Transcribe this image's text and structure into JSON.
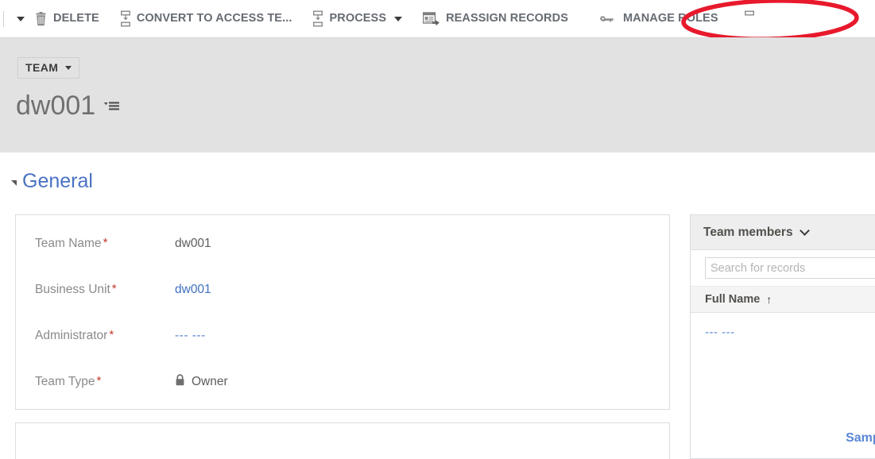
{
  "commandbar": {
    "overflow_caret_icon": "chevron-down-icon",
    "commands": [
      {
        "label": "DELETE",
        "icon": "trash-icon",
        "has_caret": false
      },
      {
        "label": "CONVERT TO ACCESS TE...",
        "icon": "hierarchy-icon",
        "has_caret": false
      },
      {
        "label": "PROCESS",
        "icon": "hierarchy-icon",
        "has_caret": true
      },
      {
        "label": "REASSIGN RECORDS",
        "icon": "reassign-records-icon",
        "has_caret": false
      },
      {
        "label": "MANAGE ROLES",
        "icon": "wrench-icon",
        "has_caret": false
      }
    ]
  },
  "record_header": {
    "entity_chip_label": "TEAM",
    "entity_chip_caret_icon": "caret-down-icon",
    "title": "dw001",
    "title_menu_icon": "record-set-menu-icon"
  },
  "form": {
    "section_title": "General",
    "collapse_icon": "triangle-collapse-icon",
    "required_marker": "*",
    "fields": [
      {
        "label": "Team Name",
        "required": true,
        "value": "dw001",
        "value_style": "text"
      },
      {
        "label": "Business Unit",
        "required": true,
        "value": "dw001",
        "value_style": "link"
      },
      {
        "label": "Administrator",
        "required": true,
        "value": "--- ---",
        "value_style": "link-dashes"
      },
      {
        "label": "Team Type",
        "required": true,
        "value": "Owner",
        "value_style": "locked",
        "lock_icon": "lock-icon"
      }
    ]
  },
  "subgrid": {
    "title": "Team members",
    "expand_icon": "chevron-down-icon",
    "search_placeholder": "Search for records",
    "search_value": "",
    "column_header": "Full Name",
    "sort_icon": "arrow-up-icon",
    "rows": [
      {
        "full_name": "--- ---"
      }
    ],
    "sample_label": "Sample"
  },
  "annotation": {
    "shape": "ellipse",
    "color": "#e8192c",
    "targets_command": "MANAGE ROLES"
  },
  "colors": {
    "header_band": "#e2e2e2",
    "command_label": "#666b72",
    "section_title": "#4a72c4",
    "link": "#3f6fc4",
    "required_star": "#c0392b",
    "annotation_red": "#e8192c"
  }
}
